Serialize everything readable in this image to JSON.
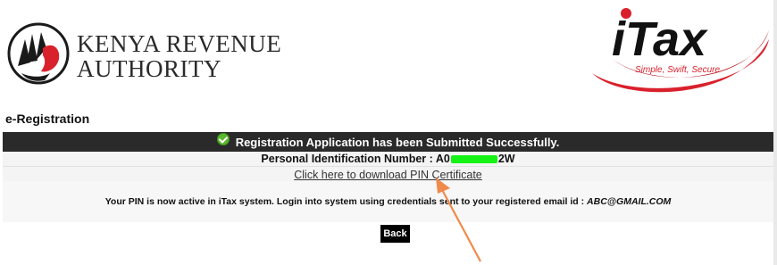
{
  "header": {
    "org_line1": "KENYA REVENUE",
    "org_line2": "AUTHORITY",
    "itax_logo_text": "iTax",
    "itax_tagline": "Simple, Swift, Secure"
  },
  "page": {
    "title": "e-Registration"
  },
  "result": {
    "success_message": "Registration Application has been Submitted Successfully.",
    "pin_label": "Personal Identification Number : ",
    "pin_visible_start": "A0",
    "pin_visible_end": "2W",
    "download_link": "Click here to download PIN Certificate",
    "info_text": "Your PIN is now active in iTax system. Login into system using credentials sent to your registered email id : ",
    "email": "ABC@GMAIL.COM"
  },
  "actions": {
    "back_label": "Back"
  },
  "colors": {
    "success_bar_bg": "#2a2a2a",
    "check_green": "#5cb82e",
    "mask_green": "#16f216",
    "arrow": "#f08a4b",
    "brand_red": "#d9212c"
  },
  "icons": {
    "success": "check-circle-icon",
    "kra_logo": "lion-head-logo"
  }
}
